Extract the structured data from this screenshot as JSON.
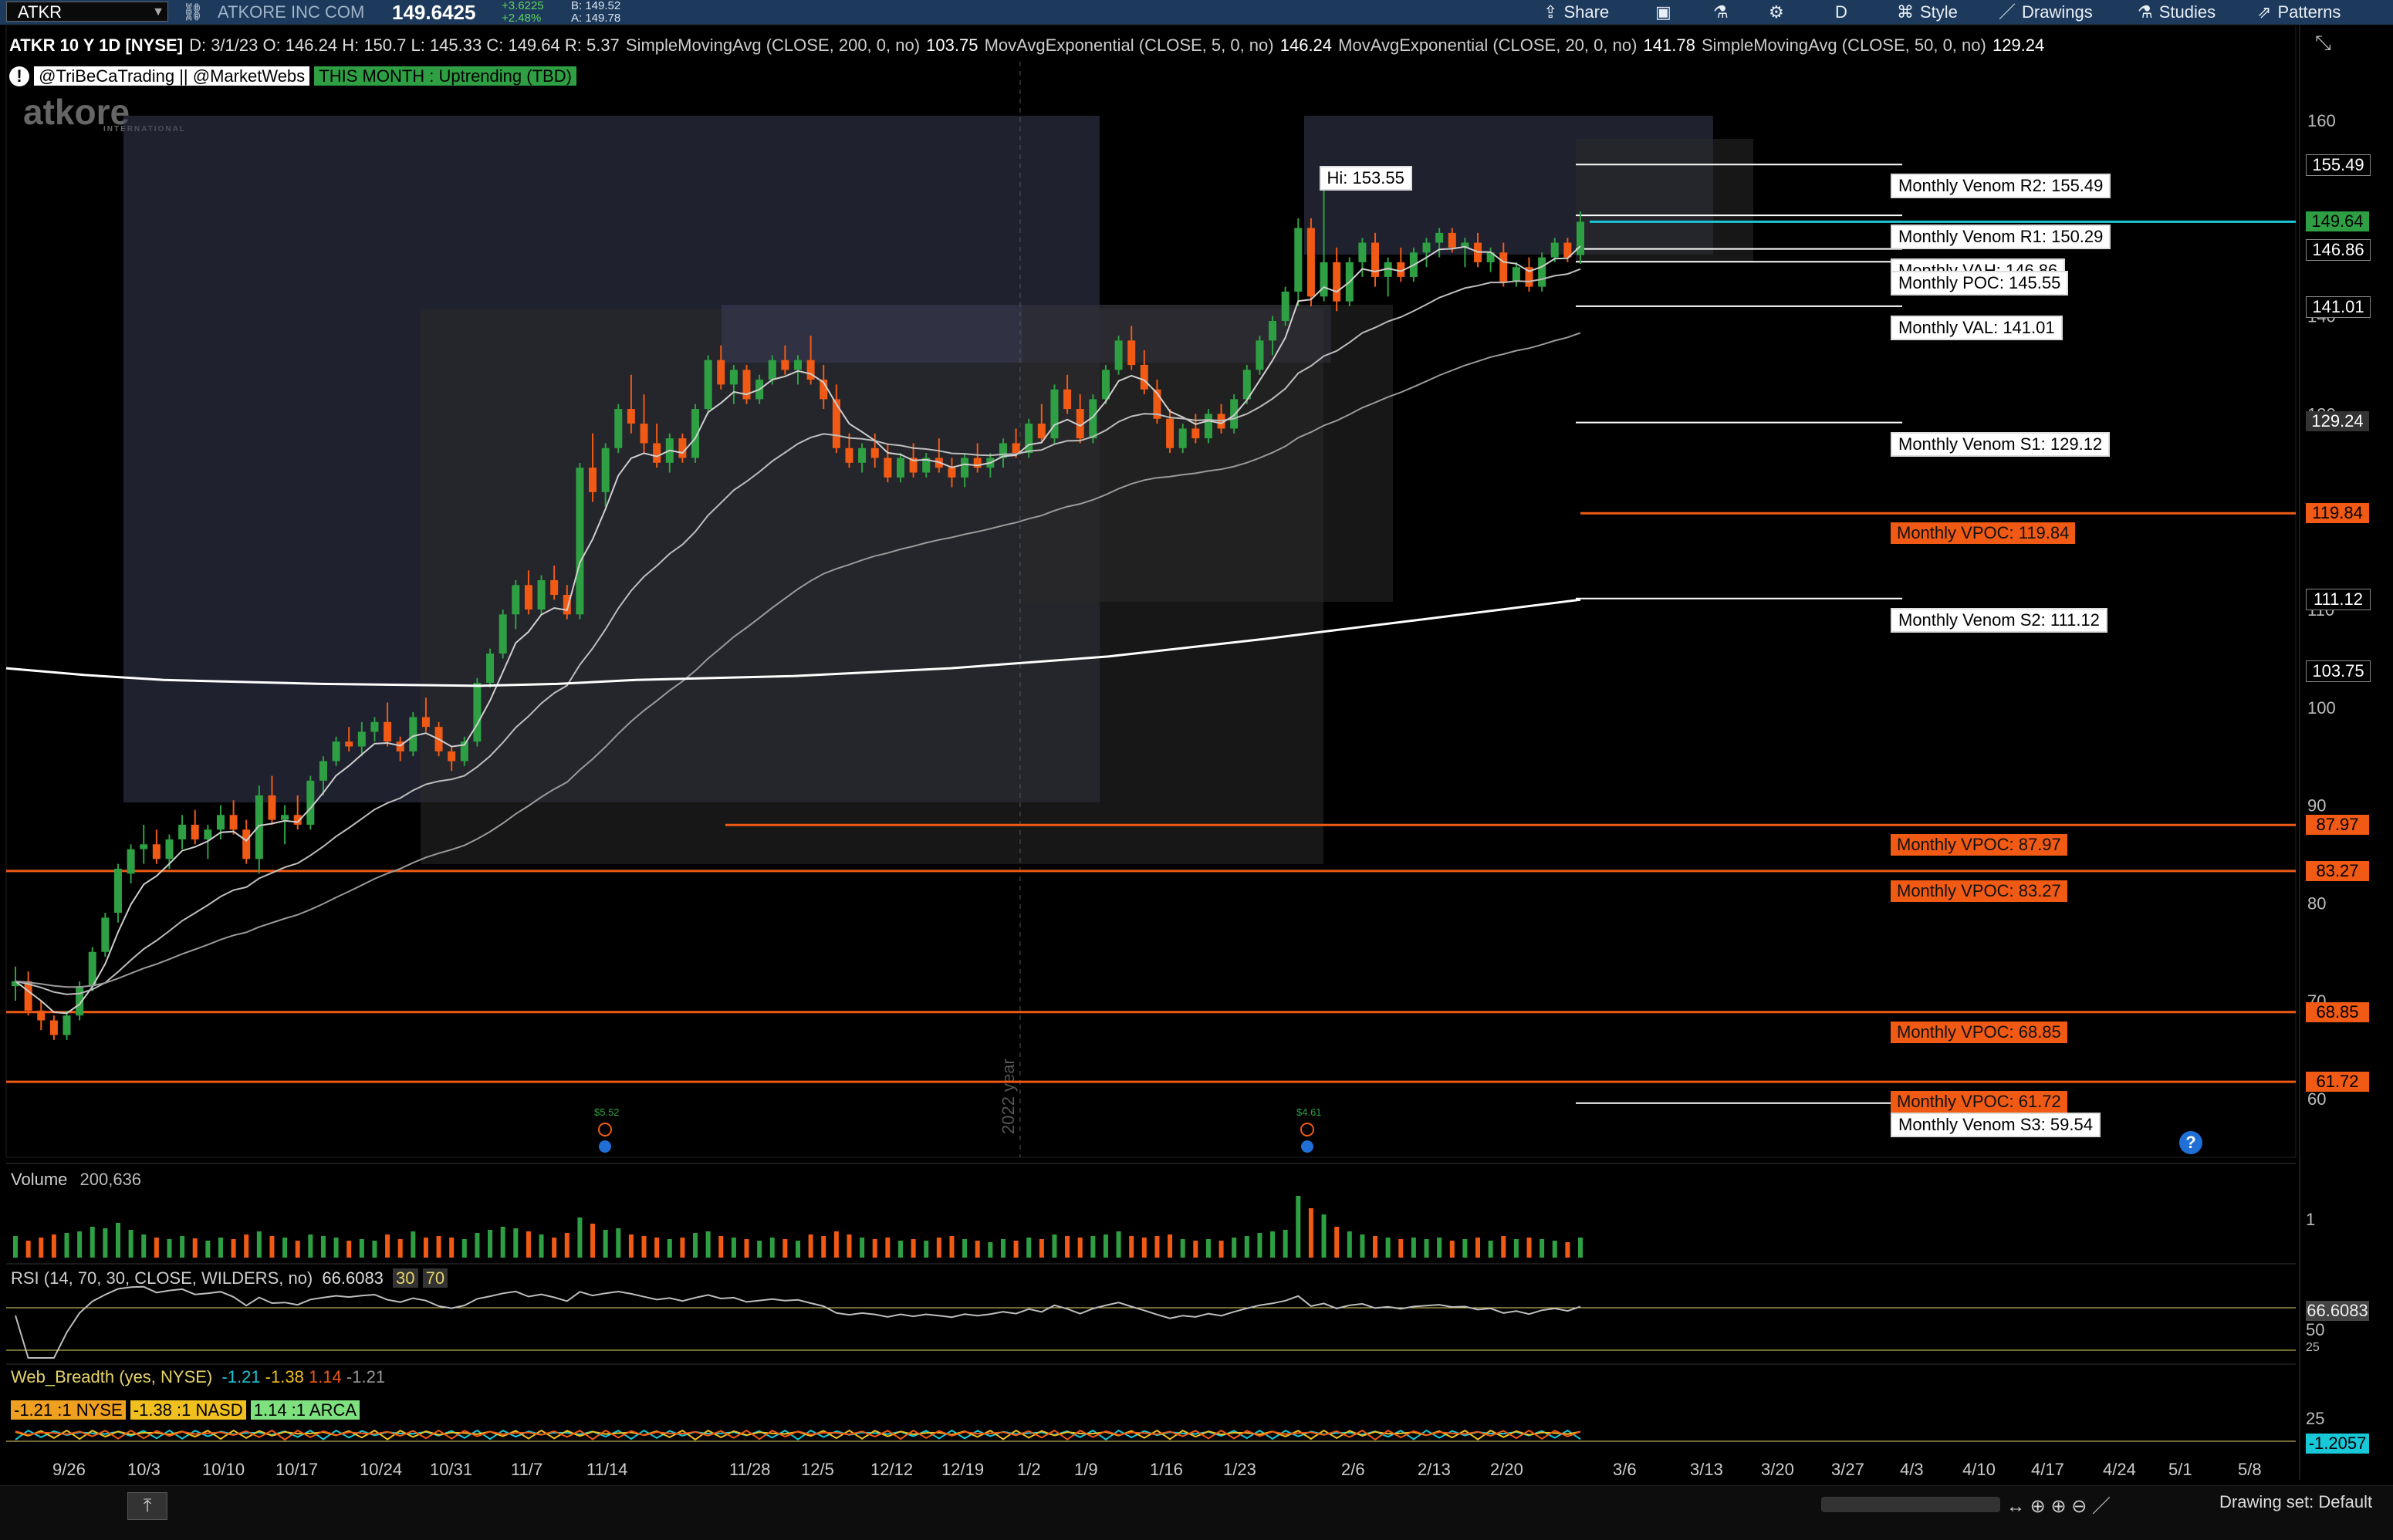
{
  "toolbar": {
    "symbol": "ATKR",
    "company": "ATKORE INC COM",
    "last": "149.6425",
    "change": "+3.6225",
    "change_pct": "+2.48%",
    "bid": "B: 149.52",
    "ask": "A: 149.78",
    "buttons": [
      "Share",
      "D",
      "Style",
      "Drawings",
      "Studies",
      "Patterns"
    ]
  },
  "study_bar": {
    "title": "ATKR 10 Y 1D [NYSE]",
    "ohlc": "D: 3/1/23   O: 146.24   H: 150.7   L: 145.33   C: 149.64   R: 5.37",
    "sma200": "SimpleMovingAvg (CLOSE, 200, 0, no)",
    "sma200_val": "103.75",
    "ema5": "MovAvgExponential (CLOSE, 5, 0, no)",
    "ema5_val": "146.24",
    "ema20": "MovAvgExponential (CLOSE, 20, 0, no)",
    "ema20_val": "141.78",
    "sma50": "SimpleMovingAvg (CLOSE, 50, 0, no)",
    "sma50_val": "129.24"
  },
  "banner": {
    "handles": "@TriBeCaTrading || @MarketWebs",
    "trend": "THIS MONTH : Uptrending (TBD)",
    "logo": "atkore",
    "logo_sub": "INTERNATIONAL"
  },
  "colors": {
    "up": "#2ea043",
    "down": "#f05a14",
    "level_orange": "#f05a14",
    "last_price_line": "#19c8d8",
    "sma200": "#ffffff",
    "ema": "#cfcfcf",
    "volume_profile": "#3a3c55"
  },
  "chart_data": {
    "type": "candlestick",
    "title": "ATKR 10 Y 1D [NYSE]",
    "price_axis_ticks": [
      160,
      140,
      130,
      120,
      110,
      100,
      90,
      80,
      70,
      60
    ],
    "ylim": [
      54,
      166
    ],
    "date_ticks": [
      "9/26",
      "10/3",
      "10/10",
      "10/17",
      "10/24",
      "10/31",
      "11/7",
      "11/14",
      "11/28",
      "12/5",
      "12/12",
      "12/19",
      "1/2",
      "1/9",
      "1/16",
      "1/23",
      "2/6",
      "2/13",
      "2/20",
      "3/6",
      "3/13",
      "3/20",
      "3/27",
      "4/3",
      "4/10",
      "4/17",
      "4/24",
      "5/1",
      "5/8"
    ],
    "separator_label": "2022 year",
    "hi_label": "Hi: 153.55",
    "levels": [
      {
        "label": "Monthly Venom R2: 155.49",
        "value": 155.49,
        "style": "white"
      },
      {
        "label": "Monthly Venom R1: 150.29",
        "value": 150.29,
        "style": "white"
      },
      {
        "label": "Monthly VAH: 146.86",
        "value": 146.86,
        "style": "white"
      },
      {
        "label": "Monthly POC: 145.55",
        "value": 145.55,
        "style": "white"
      },
      {
        "label": "Monthly VAL: 141.01",
        "value": 141.01,
        "style": "white"
      },
      {
        "label": "Monthly Venom S1: 129.12",
        "value": 129.12,
        "style": "white"
      },
      {
        "label": "Monthly VPOC: 119.84",
        "value": 119.84,
        "style": "orange"
      },
      {
        "label": "Monthly Venom S2: 111.12",
        "value": 111.12,
        "style": "white"
      },
      {
        "label": "Monthly VPOC: 87.97",
        "value": 87.97,
        "style": "orange"
      },
      {
        "label": "Monthly VPOC: 83.27",
        "value": 83.27,
        "style": "orange"
      },
      {
        "label": "Monthly VPOC: 68.85",
        "value": 68.85,
        "style": "orange"
      },
      {
        "label": "Monthly VPOC: 61.72",
        "value": 61.72,
        "style": "orange"
      },
      {
        "label": "Monthly Venom S3: 59.54",
        "value": 59.54,
        "style": "white"
      }
    ],
    "price_tags": [
      {
        "text": "155.49",
        "value": 155.49,
        "bg": "#000000",
        "fg": "#ffffff"
      },
      {
        "text": "149.64",
        "value": 149.64,
        "bg": "#2ea043",
        "fg": "#000000"
      },
      {
        "text": "146.86",
        "value": 146.86,
        "bg": "#000000",
        "fg": "#ffffff"
      },
      {
        "text": "141.01",
        "value": 141.01,
        "bg": "#000000",
        "fg": "#ffffff"
      },
      {
        "text": "129.24",
        "value": 129.24,
        "bg": "#333333",
        "fg": "#ffffff"
      },
      {
        "text": "119.84",
        "value": 119.84,
        "bg": "#f05a14",
        "fg": "#000000"
      },
      {
        "text": "111.12",
        "value": 111.12,
        "bg": "#000000",
        "fg": "#ffffff"
      },
      {
        "text": "103.75",
        "value": 103.75,
        "bg": "#000000",
        "fg": "#ffffff"
      },
      {
        "text": "87.97",
        "value": 87.97,
        "bg": "#f05a14",
        "fg": "#000000"
      },
      {
        "text": "83.27",
        "value": 83.27,
        "bg": "#f05a14",
        "fg": "#000000"
      },
      {
        "text": "68.85",
        "value": 68.85,
        "bg": "#f05a14",
        "fg": "#000000"
      },
      {
        "text": "61.72",
        "value": 61.72,
        "bg": "#f05a14",
        "fg": "#000000"
      }
    ],
    "last_price": 149.64,
    "candles": [
      [
        71.5,
        73.5,
        70,
        72,
        28
      ],
      [
        72,
        73,
        68.5,
        69,
        22
      ],
      [
        69,
        70,
        67,
        68,
        26
      ],
      [
        68,
        68.5,
        66,
        66.5,
        30
      ],
      [
        66.5,
        69,
        66,
        68.5,
        32
      ],
      [
        68.5,
        72,
        68,
        71.5,
        34
      ],
      [
        71.5,
        75.5,
        71,
        75,
        40
      ],
      [
        75,
        79,
        74.5,
        78.5,
        38
      ],
      [
        79,
        84,
        78,
        83.5,
        45
      ],
      [
        83,
        86,
        82,
        85.5,
        36
      ],
      [
        85.5,
        88,
        84,
        86,
        30
      ],
      [
        86,
        87.5,
        84,
        84.5,
        26
      ],
      [
        84.5,
        87,
        83.5,
        86.5,
        24
      ],
      [
        86.5,
        89,
        85.5,
        88,
        28
      ],
      [
        88,
        89.5,
        86,
        86.5,
        25
      ],
      [
        86.5,
        88,
        84.5,
        87.5,
        22
      ],
      [
        87.5,
        90,
        86.5,
        89,
        26
      ],
      [
        89,
        90.5,
        87,
        87.5,
        24
      ],
      [
        87.5,
        88.5,
        84,
        84.5,
        30
      ],
      [
        84.5,
        92,
        83,
        91,
        34
      ],
      [
        91,
        93,
        88,
        88.5,
        28
      ],
      [
        88.5,
        90,
        86,
        89,
        26
      ],
      [
        89,
        91,
        87.5,
        88,
        22
      ],
      [
        88,
        93,
        87.5,
        92.5,
        30
      ],
      [
        92.5,
        95,
        91,
        94.5,
        28
      ],
      [
        94.5,
        97,
        94,
        96.5,
        26
      ],
      [
        96.5,
        98,
        95.5,
        96,
        22
      ],
      [
        96,
        98.5,
        95,
        97.5,
        24
      ],
      [
        97.5,
        99,
        96.5,
        98.5,
        22
      ],
      [
        98.5,
        100.5,
        96,
        96.5,
        30
      ],
      [
        96.5,
        97,
        94.5,
        95.5,
        24
      ],
      [
        95.5,
        99.5,
        95,
        99,
        34
      ],
      [
        99,
        101,
        97.5,
        98,
        26
      ],
      [
        98,
        98.5,
        95,
        95.5,
        28
      ],
      [
        95.5,
        96,
        93.5,
        94.5,
        26
      ],
      [
        94.5,
        97,
        94,
        96.5,
        24
      ],
      [
        96.5,
        103,
        96,
        102.5,
        32
      ],
      [
        102.5,
        106,
        102,
        105.5,
        36
      ],
      [
        105.5,
        110,
        105,
        109.5,
        40
      ],
      [
        109.5,
        113,
        108,
        112.5,
        38
      ],
      [
        112.5,
        114,
        109.5,
        110,
        34
      ],
      [
        110,
        113.5,
        109.5,
        113,
        30
      ],
      [
        113,
        114.5,
        111,
        111.5,
        26
      ],
      [
        111.5,
        112.5,
        109,
        109.5,
        32
      ],
      [
        109.5,
        125,
        109,
        124.5,
        52
      ],
      [
        124.5,
        128,
        121,
        122,
        44
      ],
      [
        122,
        127,
        120.5,
        126.5,
        36
      ],
      [
        126.5,
        131,
        126,
        130.5,
        38
      ],
      [
        130.5,
        134,
        128,
        129,
        30
      ],
      [
        129,
        132,
        126,
        127,
        28
      ],
      [
        127,
        129,
        124.5,
        125,
        26
      ],
      [
        125,
        128,
        124,
        127.5,
        24
      ],
      [
        127.5,
        128,
        125,
        125.5,
        26
      ],
      [
        125.5,
        131,
        125,
        130.5,
        32
      ],
      [
        130.5,
        136,
        130,
        135.5,
        34
      ],
      [
        135.5,
        137,
        132.5,
        133,
        28
      ],
      [
        133,
        135,
        131,
        134.5,
        26
      ],
      [
        134.5,
        135,
        131,
        131.5,
        24
      ],
      [
        131.5,
        134,
        131,
        133.5,
        22
      ],
      [
        133.5,
        136,
        133,
        135.5,
        26
      ],
      [
        135.5,
        137,
        134,
        134.5,
        24
      ],
      [
        134.5,
        136,
        133,
        135.5,
        22
      ],
      [
        135.5,
        138,
        133,
        133.5,
        30
      ],
      [
        133.5,
        135,
        130.5,
        131.5,
        28
      ],
      [
        131.5,
        133,
        126,
        126.5,
        34
      ],
      [
        126.5,
        128,
        124.5,
        125,
        30
      ],
      [
        125,
        127,
        124,
        126.5,
        26
      ],
      [
        126.5,
        128,
        124.5,
        125.5,
        24
      ],
      [
        125.5,
        127,
        123,
        123.5,
        26
      ],
      [
        123.5,
        126,
        123,
        125.5,
        22
      ],
      [
        125.5,
        127,
        123.5,
        124,
        24
      ],
      [
        124,
        126,
        123.5,
        125.5,
        22
      ],
      [
        125.5,
        127.5,
        124,
        124.5,
        26
      ],
      [
        124.5,
        125.5,
        122.5,
        123.5,
        28
      ],
      [
        123.5,
        126,
        122.5,
        125.5,
        24
      ],
      [
        125.5,
        127,
        124,
        124.5,
        22
      ],
      [
        124.5,
        126,
        123.5,
        125.5,
        20
      ],
      [
        125.5,
        127.5,
        124.5,
        127,
        24
      ],
      [
        127,
        128.5,
        125.5,
        126,
        22
      ],
      [
        126,
        129.5,
        125.5,
        129,
        26
      ],
      [
        129,
        131,
        127,
        127.5,
        24
      ],
      [
        127.5,
        133,
        127,
        132.5,
        30
      ],
      [
        132.5,
        134,
        130,
        130.5,
        28
      ],
      [
        130.5,
        132,
        127,
        127.5,
        26
      ],
      [
        127.5,
        132,
        127,
        131.5,
        28
      ],
      [
        131.5,
        135,
        131,
        134.5,
        30
      ],
      [
        134.5,
        138,
        134,
        137.5,
        34
      ],
      [
        137.5,
        139,
        134.5,
        135,
        28
      ],
      [
        135,
        136.5,
        132,
        132.5,
        26
      ],
      [
        132.5,
        133.5,
        129,
        129.5,
        28
      ],
      [
        129.5,
        130.5,
        126,
        126.5,
        30
      ],
      [
        126.5,
        129,
        126,
        128.5,
        24
      ],
      [
        128.5,
        130,
        127,
        127.5,
        22
      ],
      [
        127.5,
        130.5,
        127,
        130,
        24
      ],
      [
        130,
        131,
        128,
        128.5,
        22
      ],
      [
        128.5,
        132,
        128,
        131.5,
        26
      ],
      [
        131.5,
        135,
        131,
        134.5,
        28
      ],
      [
        134.5,
        138,
        134,
        137.5,
        32
      ],
      [
        137.5,
        140,
        136,
        139.5,
        34
      ],
      [
        139.5,
        143,
        139,
        142.5,
        36
      ],
      [
        142.5,
        150,
        141,
        149,
        80
      ],
      [
        149,
        150,
        141,
        142,
        64
      ],
      [
        142,
        153.55,
        141.5,
        145.5,
        56
      ],
      [
        145.5,
        147,
        140.5,
        141.5,
        40
      ],
      [
        141.5,
        146,
        141,
        145.5,
        34
      ],
      [
        145.5,
        148,
        144,
        147.5,
        30
      ],
      [
        147.5,
        148.5,
        143,
        144,
        28
      ],
      [
        144,
        146,
        142,
        145.5,
        26
      ],
      [
        145.5,
        147,
        143.5,
        144,
        24
      ],
      [
        144,
        147,
        143.5,
        146.5,
        26
      ],
      [
        146.5,
        148,
        145,
        147.5,
        24
      ],
      [
        147.5,
        149,
        146,
        148.5,
        26
      ],
      [
        148.5,
        149,
        146.5,
        147,
        22
      ],
      [
        147,
        148,
        145,
        147.5,
        24
      ],
      [
        147.5,
        148.5,
        145,
        145.5,
        26
      ],
      [
        145.5,
        147,
        144.5,
        146.5,
        22
      ],
      [
        146.5,
        147.5,
        143,
        143.5,
        28
      ],
      [
        143.5,
        145.5,
        143,
        145,
        24
      ],
      [
        145,
        146,
        142.5,
        143,
        26
      ],
      [
        143,
        146.5,
        142.5,
        146,
        24
      ],
      [
        146,
        148,
        145.5,
        147.5,
        22
      ],
      [
        147.5,
        148,
        145.5,
        146,
        20
      ],
      [
        146.24,
        150.7,
        145.33,
        149.64,
        26
      ]
    ],
    "sma200": [
      [
        0,
        104
      ],
      [
        0.05,
        103.3
      ],
      [
        0.1,
        102.8
      ],
      [
        0.2,
        102.4
      ],
      [
        0.25,
        102.3
      ],
      [
        0.3,
        102.2
      ],
      [
        0.35,
        102.4
      ],
      [
        0.4,
        102.8
      ],
      [
        0.5,
        103.2
      ],
      [
        0.6,
        104
      ],
      [
        0.7,
        105.2
      ],
      [
        0.8,
        107
      ],
      [
        0.9,
        109
      ],
      [
        1,
        111
      ]
    ],
    "volume_pane": {
      "title": "Volume",
      "value": "200,636",
      "axis_tick": "1"
    },
    "rsi_pane": {
      "title": "RSI (14, 70, 30, CLOSE, WILDERS, no)",
      "value": "66.6083",
      "os": "30",
      "ob": "70",
      "tag": "66.6083",
      "axis_ticks": [
        "50",
        "25"
      ]
    },
    "breadth_pane": {
      "title": "Web_Breadth (yes, NYSE)",
      "vals": [
        "-1.21",
        "-1.38",
        "1.14",
        "-1.21"
      ],
      "nyse": "-1.21 :1 NYSE",
      "nasd": "-1.38 :1 NASD",
      "arca": "1.14 :1 ARCA",
      "tag": "-1.2057",
      "axis_tick": "25"
    },
    "events": [
      {
        "label": "$5.52"
      },
      {
        "label": "$4.61"
      }
    ]
  },
  "footer": {
    "drawing_set": "Drawing set: Default"
  }
}
